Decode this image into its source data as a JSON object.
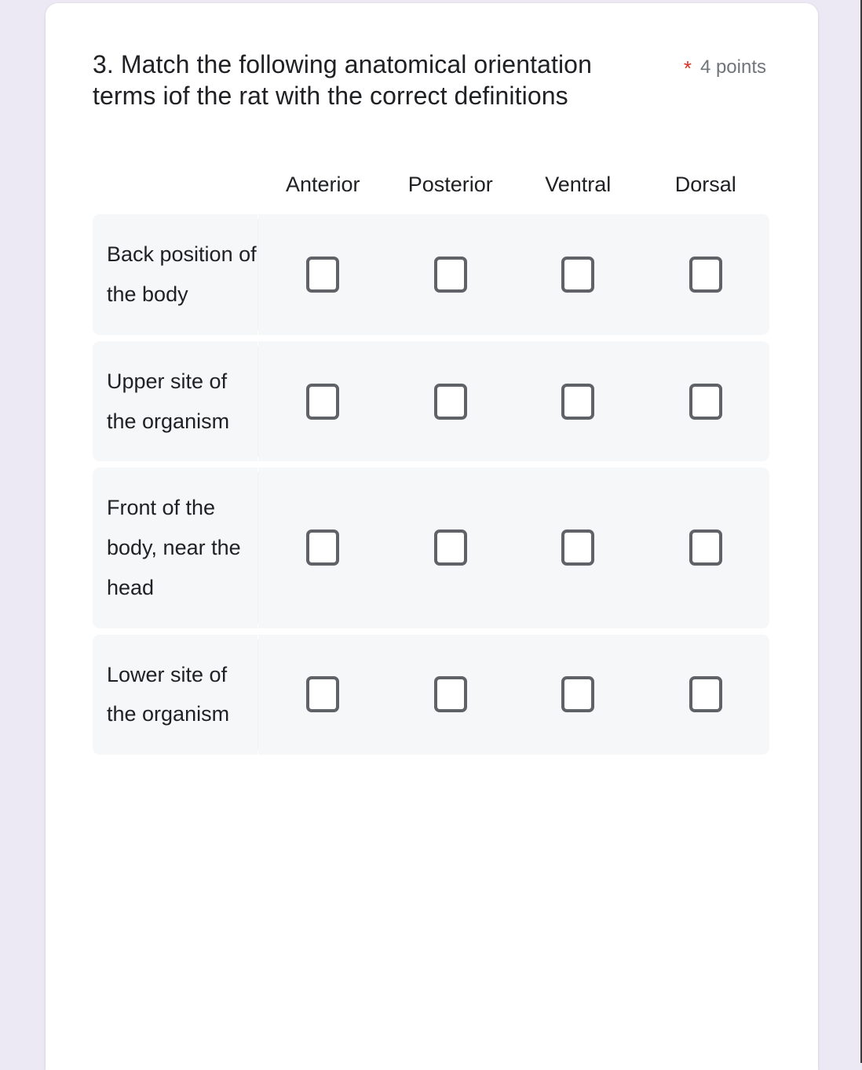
{
  "question": {
    "number": "3.",
    "title": "3. Match the following anatomical orientation terms  iof the rat with the correct definitions",
    "required_marker": "*",
    "points": "4 points"
  },
  "grid": {
    "columns": [
      "Anterior",
      "Posterior",
      "Ventral",
      "Dorsal"
    ],
    "rows": [
      {
        "label": "Back position of the body",
        "selected": null
      },
      {
        "label": "Upper site of the organism",
        "selected": null
      },
      {
        "label": "Front of the body, near the head",
        "selected": null
      },
      {
        "label": "Lower site of the organism",
        "selected": null
      }
    ]
  },
  "colors": {
    "page_background": "#ece9f4",
    "card_background": "#ffffff",
    "row_background": "#f6f7f8",
    "text_primary": "#202124",
    "text_secondary": "#70757a",
    "required_asterisk": "#d93025",
    "checkbox_border": "#5f6368",
    "scrollbar_thumb": "#7c7c83"
  },
  "scrollbar": {
    "orientation": "vertical",
    "thumb_label": "vertical-scrollbar-thumb"
  }
}
